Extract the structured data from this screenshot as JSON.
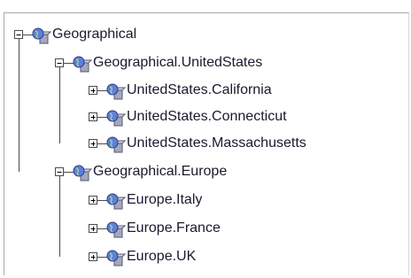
{
  "tree": {
    "title": "Geographical",
    "nodes": [
      {
        "label": "Geographical",
        "level": 0,
        "expander": "minus",
        "icon": "globe-folder-icon"
      },
      {
        "label": "Geographical.UnitedStates",
        "level": 1,
        "expander": "minus",
        "icon": "globe-folder-icon"
      },
      {
        "label": "UnitedStates.California",
        "level": 2,
        "expander": "plus",
        "icon": "globe-folder-icon"
      },
      {
        "label": "UnitedStates.Connecticut",
        "level": 2,
        "expander": "plus",
        "icon": "globe-folder-icon"
      },
      {
        "label": "UnitedStates.Massachusetts",
        "level": 2,
        "expander": "plus",
        "icon": "globe-folder-icon"
      },
      {
        "label": "Geographical.Europe",
        "level": 1,
        "expander": "minus",
        "icon": "globe-folder-icon"
      },
      {
        "label": "Europe.Italy",
        "level": 2,
        "expander": "plus",
        "icon": "globe-folder-icon"
      },
      {
        "label": "Europe.France",
        "level": 2,
        "expander": "plus",
        "icon": "globe-folder-icon"
      },
      {
        "label": "Europe.UK",
        "level": 2,
        "expander": "plus",
        "icon": "globe-folder-icon"
      }
    ]
  },
  "colors": {
    "line": "#4a4a4a",
    "text": "#1a1a2e",
    "globe": "#5f7fd9",
    "cube": "#a4a8b8"
  }
}
